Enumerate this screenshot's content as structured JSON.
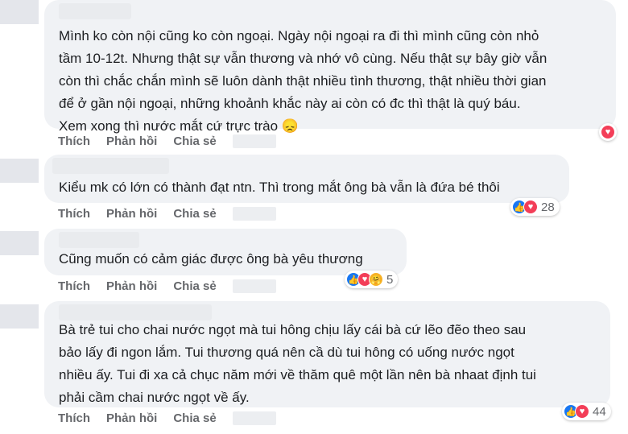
{
  "comments": [
    {
      "text": "Mình ko còn nội cũng ko còn ngoại. Ngày nội ngoại ra đi thì mình cũng còn nhỏ\ntầm 10-12t. Nhưng thật sự vẫn thương và nhớ vô cùng. Nếu thật sự bây giờ vẫn\ncòn thì chắc chắn mình sẽ luôn dành thật nhiều tình thương, thật nhiều thời gian\nđể ở gần nội ngoại, những khoảnh khắc này ai còn có đc thì thật là quý báu.\nXem xong thì nước mắt cứ trực trào 😞",
      "reactions": {
        "icons": [
          "love-icon"
        ],
        "count": ""
      }
    },
    {
      "text": "Kiểu mk có lớn có thành đạt ntn. Thì trong mắt ông bà vẫn là đứa bé thôi",
      "reactions": {
        "icons": [
          "like-icon",
          "love-icon"
        ],
        "count": "28"
      }
    },
    {
      "text": "Cũng muốn có cảm giác được ông bà yêu thương",
      "reactions": {
        "icons": [
          "like-icon",
          "love-icon",
          "care-icon"
        ],
        "count": "5"
      }
    },
    {
      "text": "Bà trẻ tui cho chai nước ngọt mà tui hông chịu lấy cái bà cứ lẽo đẽo theo sau\nbảo lấy đi ngon lắm. Tui thương quá nên cầ dù tui hông có uống nước ngọt\nnhiều ấy. Tui đi xa cả chục năm mới về thăm quê một lần nên bà nhaat định tui\nphải cầm chai nước ngọt về ấy.",
      "reactions": {
        "icons": [
          "like-icon",
          "love-icon"
        ],
        "count": "44"
      }
    }
  ],
  "actions": {
    "like": "Thích",
    "reply": "Phản hồi",
    "share": "Chia sẻ"
  },
  "icon_glyphs": {
    "like": "👍",
    "love": "♥",
    "care": "🤗"
  },
  "colors": {
    "like": "#1877f2",
    "love": "#f33e58",
    "care": "#f7b125",
    "bubble": "#f0f2f5",
    "action_text": "#65676b"
  }
}
